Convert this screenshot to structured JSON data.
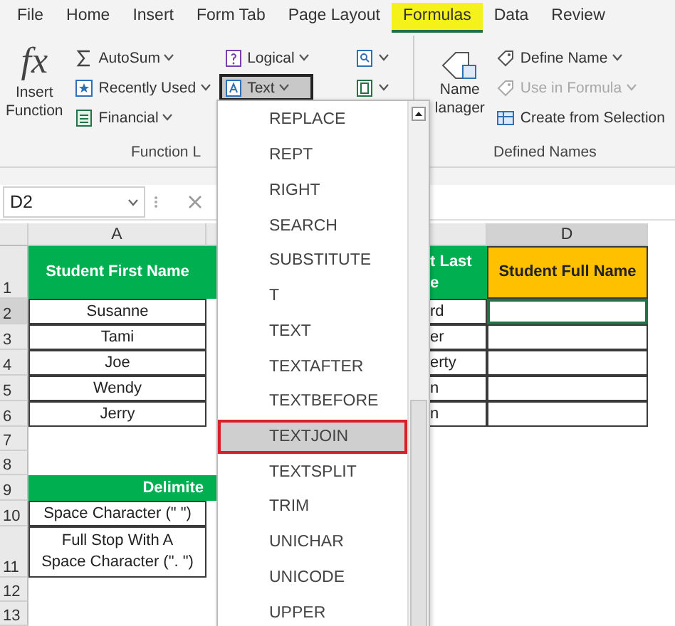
{
  "tabs": [
    {
      "label": "File",
      "selected": false
    },
    {
      "label": "Home",
      "selected": false
    },
    {
      "label": "Insert",
      "selected": false
    },
    {
      "label": "Form Tab",
      "selected": false
    },
    {
      "label": "Page Layout",
      "selected": false
    },
    {
      "label": "Formulas",
      "selected": true
    },
    {
      "label": "Data",
      "selected": false
    },
    {
      "label": "Review",
      "selected": false
    }
  ],
  "ribbon": {
    "insert_function": {
      "glyph": "fx",
      "label": "Insert\nFunction"
    },
    "library_buttons": [
      {
        "label": "AutoSum",
        "dropdown": true,
        "selected": false
      },
      {
        "label": "Recently Used",
        "dropdown": true,
        "selected": false
      },
      {
        "label": "Financial",
        "dropdown": true,
        "selected": false
      },
      {
        "label": "Logical",
        "dropdown": true,
        "selected": false
      },
      {
        "label": "Text",
        "dropdown": true,
        "selected": true
      }
    ],
    "icon_buttons": [
      {
        "dropdown": true
      },
      {
        "dropdown": true
      }
    ],
    "library_label": "Function L",
    "name_manager": {
      "label": "Name\nlanager"
    },
    "name_buttons": [
      {
        "label": "Define Name",
        "dropdown": true,
        "disabled": false
      },
      {
        "label": "Use in Formula",
        "dropdown": true,
        "disabled": true
      },
      {
        "label": "Create from Selection",
        "dropdown": false,
        "disabled": false
      }
    ],
    "names_label": "Defined Names"
  },
  "formula_bar": {
    "name_box": "D2"
  },
  "sheet": {
    "columns": [
      {
        "label": "A",
        "selected": false
      },
      {
        "label": "D",
        "selected": true
      }
    ],
    "rows": [
      {
        "number": "1",
        "kind": "header",
        "selected": false,
        "a": "Student First Name",
        "c": "t Last\ne",
        "d": "Student Full Name",
        "d_selected": false
      },
      {
        "number": "2",
        "kind": "data",
        "selected": true,
        "a": "Susanne",
        "c": "rd",
        "d_selected": true
      },
      {
        "number": "3",
        "kind": "data",
        "selected": false,
        "a": "Tami",
        "c": "er",
        "d_selected": false
      },
      {
        "number": "4",
        "kind": "data",
        "selected": false,
        "a": "Joe",
        "c": "erty",
        "d_selected": false
      },
      {
        "number": "5",
        "kind": "data",
        "selected": false,
        "a": "Wendy",
        "c": "n",
        "d_selected": false
      },
      {
        "number": "6",
        "kind": "data",
        "selected": false,
        "a": "Jerry",
        "c": "n",
        "d_selected": false
      },
      {
        "number": "7",
        "kind": "blank",
        "selected": false
      },
      {
        "number": "8",
        "kind": "blank",
        "selected": false
      },
      {
        "number": "9",
        "kind": "delimiter_header",
        "selected": false,
        "a": "Delimite"
      },
      {
        "number": "10",
        "kind": "delimiter",
        "selected": false,
        "a": "Space Character (\" \")"
      },
      {
        "number": "11",
        "kind": "delimiter_tall",
        "selected": false,
        "a": "Full Stop With A\nSpace Character (\". \")"
      },
      {
        "number": "12",
        "kind": "blank",
        "selected": false
      },
      {
        "number": "13",
        "kind": "blank",
        "selected": false
      }
    ]
  },
  "menu": {
    "items": [
      {
        "label": "REPLACE",
        "selected": false
      },
      {
        "label": "REPT",
        "selected": false
      },
      {
        "label": "RIGHT",
        "selected": false
      },
      {
        "label": "SEARCH",
        "selected": false
      },
      {
        "label": "SUBSTITUTE",
        "selected": false
      },
      {
        "label": "T",
        "selected": false
      },
      {
        "label": "TEXT",
        "selected": false
      },
      {
        "label": "TEXTAFTER",
        "selected": false
      },
      {
        "label": "TEXTBEFORE",
        "selected": false
      },
      {
        "label": "TEXTJOIN",
        "selected": true
      },
      {
        "label": "TEXTSPLIT",
        "selected": false
      },
      {
        "label": "TRIM",
        "selected": false
      },
      {
        "label": "UNICHAR",
        "selected": false
      },
      {
        "label": "UNICODE",
        "selected": false
      },
      {
        "label": "UPPER",
        "selected": false
      }
    ]
  }
}
